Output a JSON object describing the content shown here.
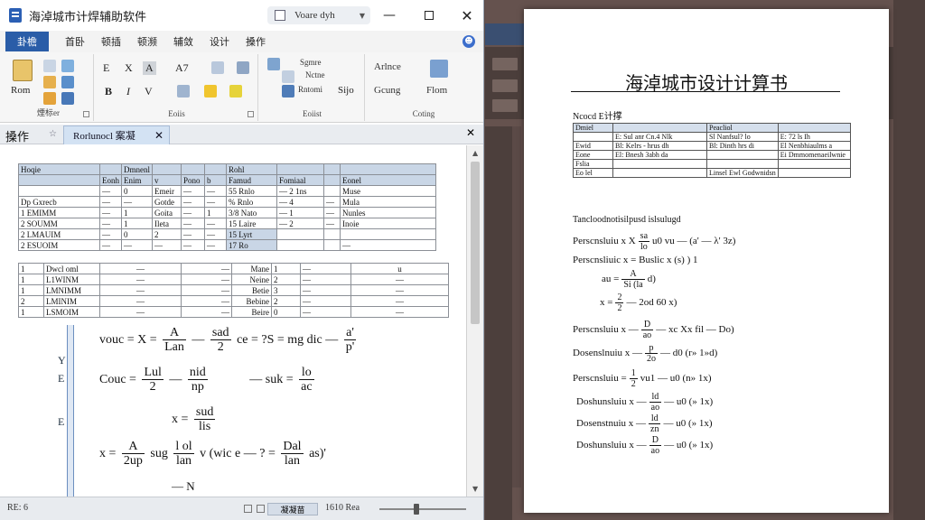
{
  "window": {
    "title": "海淖城市计焊辅助软件",
    "tab_pill": "Voare dyh",
    "controls": {
      "minimize": "—",
      "maximize": "",
      "close": "✕"
    }
  },
  "menu": {
    "file": "卦檐",
    "items": [
      "首卧",
      "顿插",
      "顿濒",
      "辅敛",
      "设计",
      "搡作"
    ],
    "help": "☻"
  },
  "ribbon": {
    "groups": [
      {
        "label": "煙标er",
        "paste": "Rom"
      },
      {
        "label": "Eoiis",
        "buttons": [
          "E",
          "X",
          "A",
          "A7",
          "B",
          "I",
          "V"
        ]
      },
      {
        "label": "Eoiist",
        "items": [
          "Sgmre",
          "Nctne",
          "Rntomi",
          "Sijo"
        ]
      },
      {
        "label": "Coting",
        "items": [
          "Arlnce",
          "Gcung",
          "Flom"
        ]
      }
    ]
  },
  "doc_tabs": {
    "active_label": "搡作",
    "file_tab": "Rorlunocl 案凝",
    "close": "✕",
    "pin": "☆",
    "panel_close": "✕"
  },
  "grid_top": {
    "rows": [
      [
        "Hoqie",
        "",
        "Dmnenl",
        "",
        "",
        "",
        "Rohl",
        "",
        "",
        ""
      ],
      [
        "",
        "Eonh",
        "Enim",
        "v",
        "Pono",
        "b",
        "Famud",
        "Fomiaal",
        "",
        "Eonel"
      ],
      [
        "",
        "—",
        "0",
        "Emeir",
        "—",
        "—",
        "55 Rnlo",
        "— 2 1ns",
        "",
        "Muse"
      ],
      [
        "Dp Gxrecb",
        "—",
        "—",
        "Gotde",
        "—",
        "—",
        "% Rnlo",
        "— 4",
        "—",
        "Mula"
      ],
      [
        "1 EMIMM",
        "—",
        "1",
        "Goita",
        "—",
        "1",
        "3/8 Nato",
        "— 1",
        "—",
        "Nunles"
      ],
      [
        "2 SOUMM",
        "—",
        "1",
        "Ileta",
        "—",
        "—",
        "15 Laire",
        "— 2",
        "—",
        "Inoie"
      ],
      [
        "2 LMAUIM",
        "—",
        "0",
        "2",
        "—",
        "—",
        "15 Lyrt",
        "",
        "",
        ""
      ],
      [
        "2 ESUOIM",
        "—",
        "—",
        "—",
        "—",
        "—",
        "17 Ro",
        "",
        "",
        "—"
      ]
    ]
  },
  "grid_bottom": {
    "rows": [
      [
        "1",
        "Dwcl oml",
        "—",
        "—",
        "Mane",
        "1",
        "—",
        "u"
      ],
      [
        "1",
        "L1WINM",
        "—",
        "—",
        "Neine",
        "2",
        "—",
        "—"
      ],
      [
        "1",
        "LMNIMM",
        "—",
        "—",
        "Betie",
        "3",
        "—",
        "—"
      ],
      [
        "2",
        "LMINIM",
        "—",
        "—",
        "Bebine",
        "2",
        "—",
        "—"
      ],
      [
        "1",
        "LSMOIM",
        "—",
        "—",
        "Beire",
        "0",
        "—",
        "—"
      ]
    ]
  },
  "formulas_left": {
    "f1_pre": "vouc = X =",
    "f1_num": "A",
    "f1_den": "Lan",
    "f1_mid": "—",
    "f1_num2": "sad",
    "f1_den2": "2",
    "f1_post": "ce = ?S = mg  dic —",
    "f1_num3": "a'",
    "f1_den3": "p'",
    "f2_pre": "Couc =",
    "f2_num": "Lul",
    "f2_den": "2",
    "f2_mid": "—",
    "f2_num2": "nid",
    "f2_den2": "np",
    "f2_post": "— suk =",
    "f2_num3": "lo",
    "f2_den3": "ac",
    "f3_pre": "x =",
    "f3_num": "sud",
    "f3_den": "lis",
    "f4_pre": "x =",
    "f4_num": "A",
    "f4_den": "2up",
    "f4_mid": "sug",
    "f4_num2": "l ol",
    "f4_den2": "lan",
    "f4_post": "v (wic e — ?  =",
    "f4_num3": "Dal",
    "f4_den3": "lan",
    "f4_tail": "as)'",
    "f5_pre": "—",
    "f5_num": "N"
  },
  "ruler_marks": [
    "Y",
    "E",
    "E"
  ],
  "statusbar": {
    "left": "RE: 6",
    "views": "凝凝苗",
    "zoom": "1610 Rea"
  },
  "slider": {
    "value": 0.42
  },
  "preview": {
    "title": "海淖城市设计计算书",
    "subtitle": "Ncocd E计撑",
    "section": "Tancloodnotisilpusd islsulugd",
    "table": {
      "header": [
        "Dmiel",
        "",
        "Peacliol",
        ""
      ],
      "rows": [
        [
          "",
          "E: Sul anr Cn.4 Nlk",
          "Sl Nanfsul? lo",
          "E: 72 ls Ih"
        ],
        [
          "Ewid",
          "Bl: Kelrs - hrus dh",
          "Bl: Dinth hrs di",
          "El Nenbhiaulms a"
        ],
        [
          "Eone",
          "El: Bnesh 3abh da",
          "",
          "Ei Dmmomenaeilwnie"
        ],
        [
          "Fslia",
          "",
          "",
          ""
        ],
        [
          "Eo lel",
          "",
          "Linsel Ewl Godwnidsn",
          ""
        ]
      ]
    },
    "formulas": [
      {
        "pre": "Perscnsluiu x X",
        "num": "sa",
        "den": "lo",
        "post": "u0 vu — (a' — λ' 3z)"
      },
      {
        "pre": "Perscnsliuic x = Buslic",
        "num": "",
        "den": "",
        "post": "x (s) ) 1"
      },
      {
        "pre": "au =",
        "num": "A",
        "den": "Si (la",
        "post": "d)"
      },
      {
        "pre": "x =",
        "num": "2",
        "den": "2",
        "post": "— 2od  60 x)"
      },
      {
        "pre": "Perscnsluiu x —",
        "num": "D",
        "den": "ao",
        "post": "— xc Xx fil — Do)"
      },
      {
        "pre": "Dosenslnuiu x —",
        "num": "p",
        "den": "2o",
        "post": "— d0 (r» 1»d)"
      },
      {
        "pre": "Perscnsluiu =",
        "num": "1",
        "den": "2",
        "post": "vu1 — u0 (n» 1x)"
      },
      {
        "pre": "Doshunsluiu x —",
        "num": "ld",
        "den": "ao",
        "post": "— u0 (» 1x)"
      },
      {
        "pre": "Dosenstnuiu x —",
        "num": "ld",
        "den": "zn",
        "post": "— u0 (» 1x)"
      },
      {
        "pre": "Doshunsluiu x —",
        "num": "D",
        "den": "ao",
        "post": "— u0 (» 1x)"
      }
    ]
  },
  "colors": {
    "accent": "#2a5da8",
    "table_header": "#c9d6e6",
    "background": "#5b4b47"
  }
}
